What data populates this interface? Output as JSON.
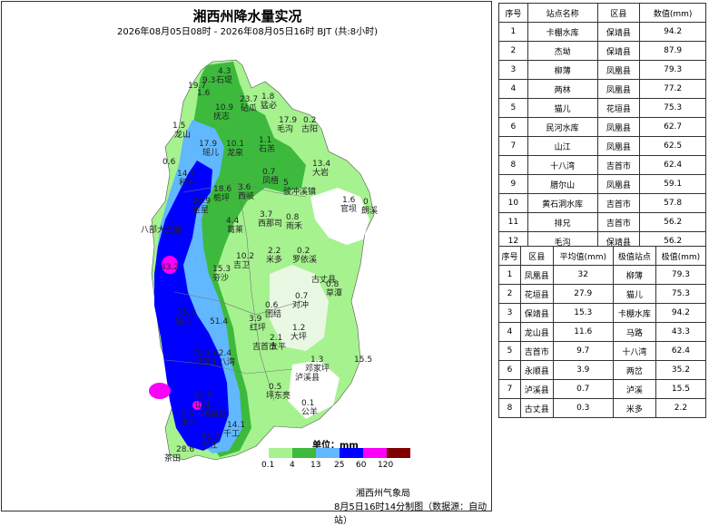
{
  "map": {
    "title": "湘西州降水量实况",
    "subtitle": "2026年08月05日08时 - 2026年08月05日16时 BJT (共:8小时)",
    "legend": {
      "title": "单位：mm",
      "ticks": [
        "0.1",
        "4",
        "13",
        "25",
        "60",
        "120"
      ],
      "colors": [
        "#a6f28f",
        "#3dba3d",
        "#61b8ff",
        "#0000fe",
        "#fa00fa",
        "#800000"
      ]
    },
    "labels": [
      {
        "text": "4.3"
      },
      {
        "text": "石堤"
      },
      {
        "text": "9.3"
      },
      {
        "text": "19.7"
      },
      {
        "text": "1.6"
      },
      {
        "text": "10.9"
      },
      {
        "text": "抚志"
      },
      {
        "text": "23.7"
      },
      {
        "text": "砧瓜"
      },
      {
        "text": "1.8"
      },
      {
        "text": "猛必"
      },
      {
        "text": "1.5"
      },
      {
        "text": "龙山"
      },
      {
        "text": "17.9"
      },
      {
        "text": "瑶儿"
      },
      {
        "text": "10.1"
      },
      {
        "text": "龙泉"
      },
      {
        "text": "17.9"
      },
      {
        "text": "毛沟"
      },
      {
        "text": "0.2"
      },
      {
        "text": "古阳"
      },
      {
        "text": "1.1"
      },
      {
        "text": "石羔"
      },
      {
        "text": "0.6"
      },
      {
        "text": "14.1"
      },
      {
        "text": "和平"
      },
      {
        "text": "0.7"
      },
      {
        "text": "凤梧"
      },
      {
        "text": "13.4"
      },
      {
        "text": "大岩"
      },
      {
        "text": "18.6"
      },
      {
        "text": "栀坪"
      },
      {
        "text": "3.6"
      },
      {
        "text": "西岐"
      },
      {
        "text": "5"
      },
      {
        "text": "骏冲溪镇"
      },
      {
        "text": "20.9"
      },
      {
        "text": "金星"
      },
      {
        "text": "1.6"
      },
      {
        "text": "官坝"
      },
      {
        "text": "0"
      },
      {
        "text": "朗溪"
      },
      {
        "text": "3.7"
      },
      {
        "text": "西那司"
      },
      {
        "text": "0.8"
      },
      {
        "text": "雨禾"
      },
      {
        "text": "八部大王庙"
      },
      {
        "text": "4.4"
      },
      {
        "text": "葛莱"
      },
      {
        "text": "2.2"
      },
      {
        "text": "米多"
      },
      {
        "text": "0.2"
      },
      {
        "text": "罗依溪"
      },
      {
        "text": "10.2"
      },
      {
        "text": "吉卫"
      },
      {
        "text": "15.3"
      },
      {
        "text": "夯沙"
      },
      {
        "text": "43.2"
      },
      {
        "text": "古丈县"
      },
      {
        "text": "0.8"
      },
      {
        "text": "草潭"
      },
      {
        "text": "0.6"
      },
      {
        "text": "团结"
      },
      {
        "text": "0.7"
      },
      {
        "text": "对冲"
      },
      {
        "text": "75.3"
      },
      {
        "text": "猫儿"
      },
      {
        "text": "51.4"
      },
      {
        "text": "3.9"
      },
      {
        "text": "红坪"
      },
      {
        "text": "1.2"
      },
      {
        "text": "大坪"
      },
      {
        "text": "2.1"
      },
      {
        "text": "太平"
      },
      {
        "text": "吉首市"
      },
      {
        "text": "79.3"
      },
      {
        "text": "62.4"
      },
      {
        "text": "柳薄"
      },
      {
        "text": "十八湾"
      },
      {
        "text": "1.3"
      },
      {
        "text": "邓家坪"
      },
      {
        "text": "泸溪县"
      },
      {
        "text": "15.5"
      },
      {
        "text": "0.5"
      },
      {
        "text": "坪东亮"
      },
      {
        "text": "62.5"
      },
      {
        "text": "山江"
      },
      {
        "text": "0.1"
      },
      {
        "text": "公羊"
      },
      {
        "text": "凤凰县"
      },
      {
        "text": "2.5"
      },
      {
        "text": "木叶"
      },
      {
        "text": "41.7"
      },
      {
        "text": "三江"
      },
      {
        "text": "14.1"
      },
      {
        "text": "千工"
      },
      {
        "text": "28.6"
      },
      {
        "text": "茶田"
      }
    ]
  },
  "footer": {
    "org": "湘西州气象局",
    "note": "8月5日16时14分制图（数据源：自动站）"
  },
  "stations_table": {
    "headers": [
      "序号",
      "站点名称",
      "区县",
      "数值(mm)"
    ],
    "rows": [
      [
        "1",
        "卡棚水库",
        "保靖县",
        "94.2"
      ],
      [
        "2",
        "杰坳",
        "保靖县",
        "87.9"
      ],
      [
        "3",
        "柳薄",
        "凤凰县",
        "79.3"
      ],
      [
        "4",
        "两林",
        "凤凰县",
        "77.2"
      ],
      [
        "5",
        "猫儿",
        "花垣县",
        "75.3"
      ],
      [
        "6",
        "民河水库",
        "凤凰县",
        "62.7"
      ],
      [
        "7",
        "山江",
        "凤凰县",
        "62.5"
      ],
      [
        "8",
        "十八湾",
        "吉首市",
        "62.4"
      ],
      [
        "9",
        "腊尔山",
        "凤凰县",
        "59.1"
      ],
      [
        "10",
        "黄石洞水库",
        "吉首市",
        "57.8"
      ],
      [
        "11",
        "排兄",
        "吉首市",
        "56.2"
      ],
      [
        "12",
        "毛沟",
        "保靖县",
        "56.2"
      ]
    ]
  },
  "counties_table": {
    "headers": [
      "序号",
      "区县",
      "平均值(mm)",
      "极值站点",
      "极值(mm)"
    ],
    "rows": [
      [
        "1",
        "凤凰县",
        "32",
        "柳薄",
        "79.3"
      ],
      [
        "2",
        "花垣县",
        "27.9",
        "猫儿",
        "75.3"
      ],
      [
        "3",
        "保靖县",
        "15.3",
        "卡棚水库",
        "94.2"
      ],
      [
        "4",
        "龙山县",
        "11.6",
        "马路",
        "43.3"
      ],
      [
        "5",
        "吉首市",
        "9.7",
        "十八湾",
        "62.4"
      ],
      [
        "6",
        "永顺县",
        "3.9",
        "两岔",
        "35.2"
      ],
      [
        "7",
        "泸溪县",
        "0.7",
        "泸溪",
        "15.5"
      ],
      [
        "8",
        "古丈县",
        "0.3",
        "米多",
        "2.2"
      ]
    ]
  }
}
